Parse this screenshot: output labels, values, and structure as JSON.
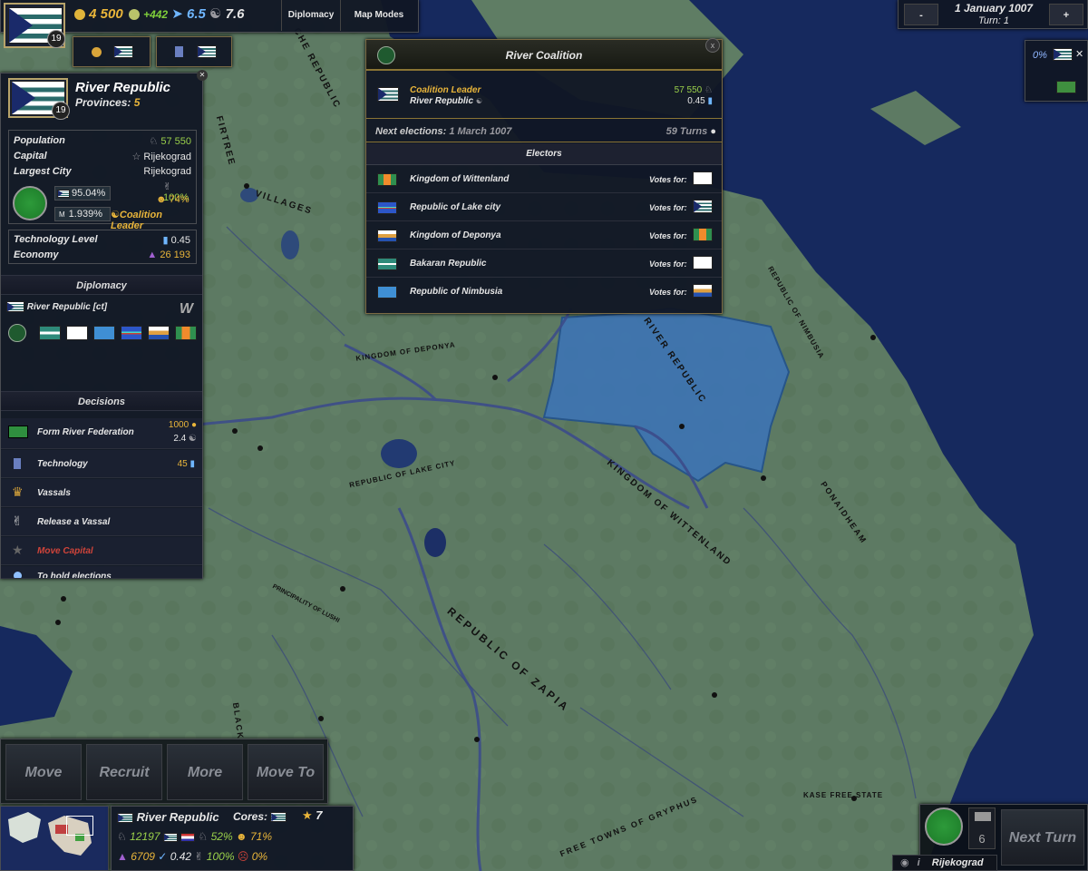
{
  "topbar": {
    "gold": "4 500",
    "income": "+442",
    "military": "6.5",
    "stability": "7.6",
    "diplomacy_tab": "Diplomacy",
    "mapmodes_tab": "Map Modes",
    "rank": "19"
  },
  "date": {
    "minus": "-",
    "plus": "+",
    "date": "1 January 1007",
    "turn": "Turn: 1"
  },
  "top_right": {
    "percent": "0%"
  },
  "country": {
    "name": "River Republic",
    "provinces_label": "Provinces:",
    "provinces": "5",
    "rank": "19",
    "rows": [
      {
        "label": "Population",
        "value": "57 550"
      },
      {
        "label": "Capital",
        "value": "Rijekograd"
      },
      {
        "label": "Largest City",
        "value": "Rijekograd"
      }
    ],
    "pct_main": "95.04%",
    "pct_main_side": "100%",
    "pct_second": "1.939%",
    "happiness": "74%",
    "status": "Coalition Leader",
    "tech_label": "Technology Level",
    "tech_value": "0.45",
    "econ_label": "Economy",
    "econ_value": "26 193"
  },
  "diplomacy": {
    "title": "Diplomacy",
    "entry": "River Republic [ct]"
  },
  "decisions": {
    "title": "Decisions",
    "items": [
      {
        "label": "Form River Federation",
        "cost1": "1000",
        "cost2": "2.4"
      },
      {
        "label": "Technology",
        "cost1": "45",
        "cost2": ""
      },
      {
        "label": "Vassals",
        "cost1": "",
        "cost2": ""
      },
      {
        "label": "Release a Vassal",
        "cost1": "",
        "cost2": ""
      },
      {
        "label": "Move Capital",
        "cost1": "",
        "cost2": ""
      },
      {
        "label": "To hold elections",
        "cost1": "",
        "cost2": ""
      }
    ]
  },
  "coalition": {
    "title": "River Coalition",
    "close": "x",
    "leader_label": "Coalition Leader",
    "leader": "River Republic",
    "leader_pop": "57 550",
    "leader_tech": "0.45",
    "next_label": "Next elections:",
    "next_date": "1 March 1007",
    "turns": "59 Turns",
    "electors_title": "Electors",
    "votes_label": "Votes for:",
    "electors": [
      {
        "name": "Kingdom of Wittenland"
      },
      {
        "name": "Republic of Lake city"
      },
      {
        "name": "Kingdom of Deponya"
      },
      {
        "name": "Bakaran Republic"
      },
      {
        "name": "Republic of Nimbusia"
      }
    ]
  },
  "map_labels": [
    "FIRTREE",
    "VILLAGES",
    "KINGDOM OF DEPONYA",
    "RIVER REPUBLIC",
    "REPUBLIC OF NIMBUSIA",
    "REPUBLIC OF LAKE CITY",
    "KINGDOM OF WITTENLAND",
    "PONAIDHEAM",
    "REPUBLIC OF ZAPIA",
    "PRINCIPALITY OF LUSHI",
    "FREE TOWNS OF GRYPHUS",
    "KASE FREE STATE",
    "CHE REPUBLIC",
    "BLACK"
  ],
  "actions": {
    "move": "Move",
    "recruit": "Recruit",
    "more": "More",
    "moveto": "Move To"
  },
  "bottom": {
    "name": "River Republic",
    "cores_label": "Cores:",
    "stars": "7",
    "pop": "12197",
    "pct1": "52%",
    "pct2": "71%",
    "econ": "6709",
    "tech": "0.42",
    "pct3": "100%",
    "pct4": "0%"
  },
  "bottom_right": {
    "next_turn": "Next Turn",
    "count": "6",
    "city": "Rijekograd"
  }
}
